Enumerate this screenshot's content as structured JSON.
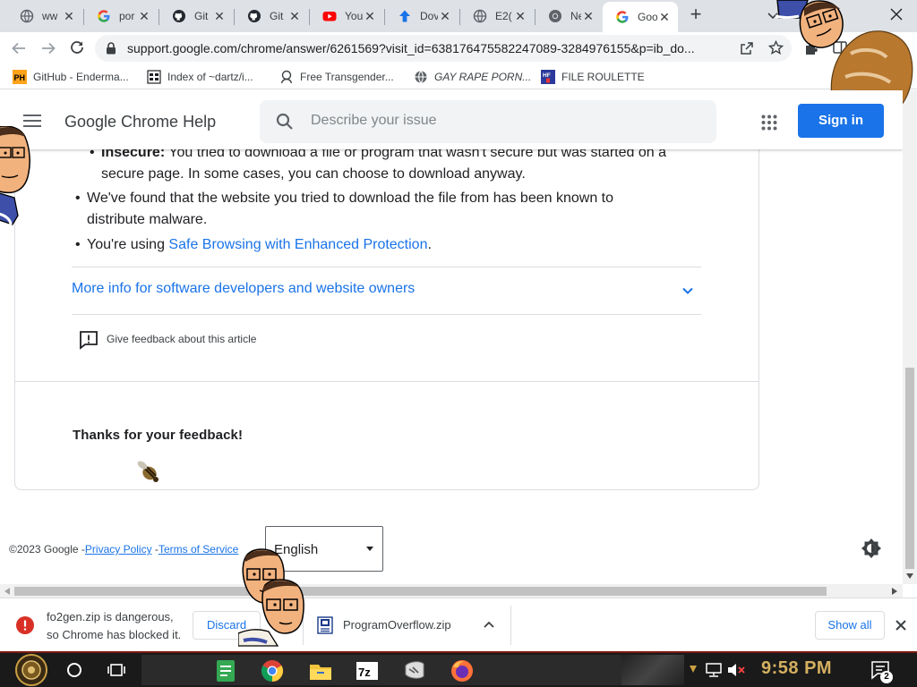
{
  "tabs": [
    {
      "title": "ww"
    },
    {
      "title": "por"
    },
    {
      "title": "Git"
    },
    {
      "title": "Git"
    },
    {
      "title": "You"
    },
    {
      "title": "Dov"
    },
    {
      "title": "E2("
    },
    {
      "title": "New"
    },
    {
      "title": "Goo",
      "active": true
    }
  ],
  "toolbar": {
    "url": "support.google.com/chrome/answer/6261569?visit_id=638176475582247089-3284976155&p=ib_do..."
  },
  "bookmarks": [
    {
      "label": "GitHub - Enderma..."
    },
    {
      "label": "Index of ~dartz/i..."
    },
    {
      "label": "Free Transgender..."
    },
    {
      "label": "GAY RAPE PORN..."
    },
    {
      "label": "FILE ROULETTE"
    }
  ],
  "header": {
    "title": "Google Chrome Help",
    "search_placeholder": "Describe your issue",
    "signin_label": "Sign in"
  },
  "article": {
    "insecure_label": "Insecure:",
    "insecure_text": "You tried to download a file or program that wasn't secure but was started on a secure page. In some cases, you can choose to download anyway.",
    "malware_text": "We've found that the website you tried to download the file from has been known to distribute malware.",
    "safe_prefix": "You're using ",
    "safe_link": "Safe Browsing with Enhanced Protection",
    "safe_suffix": ".",
    "more_info": "More info for software developers and website owners",
    "feedback_label": "Give feedback about this article",
    "thanks": "Thanks for your feedback!"
  },
  "footer": {
    "copyright": "©2023 Google -",
    "privacy": "Privacy Policy",
    "sep": " -",
    "terms": "Terms of Service",
    "language": "English"
  },
  "downloads": {
    "blocked_line1": "fo2gen.zip is dangerous,",
    "blocked_line2": "so Chrome has blocked it.",
    "discard_label": "Discard",
    "file2": "ProgramOverflow.zip",
    "show_all": "Show all"
  },
  "taskbar": {
    "time": "9:58 PM",
    "notifications": "2"
  },
  "colors": {
    "accent": "#1a73e8",
    "danger": "#d93025",
    "tabstrip": "#dee1e6"
  }
}
